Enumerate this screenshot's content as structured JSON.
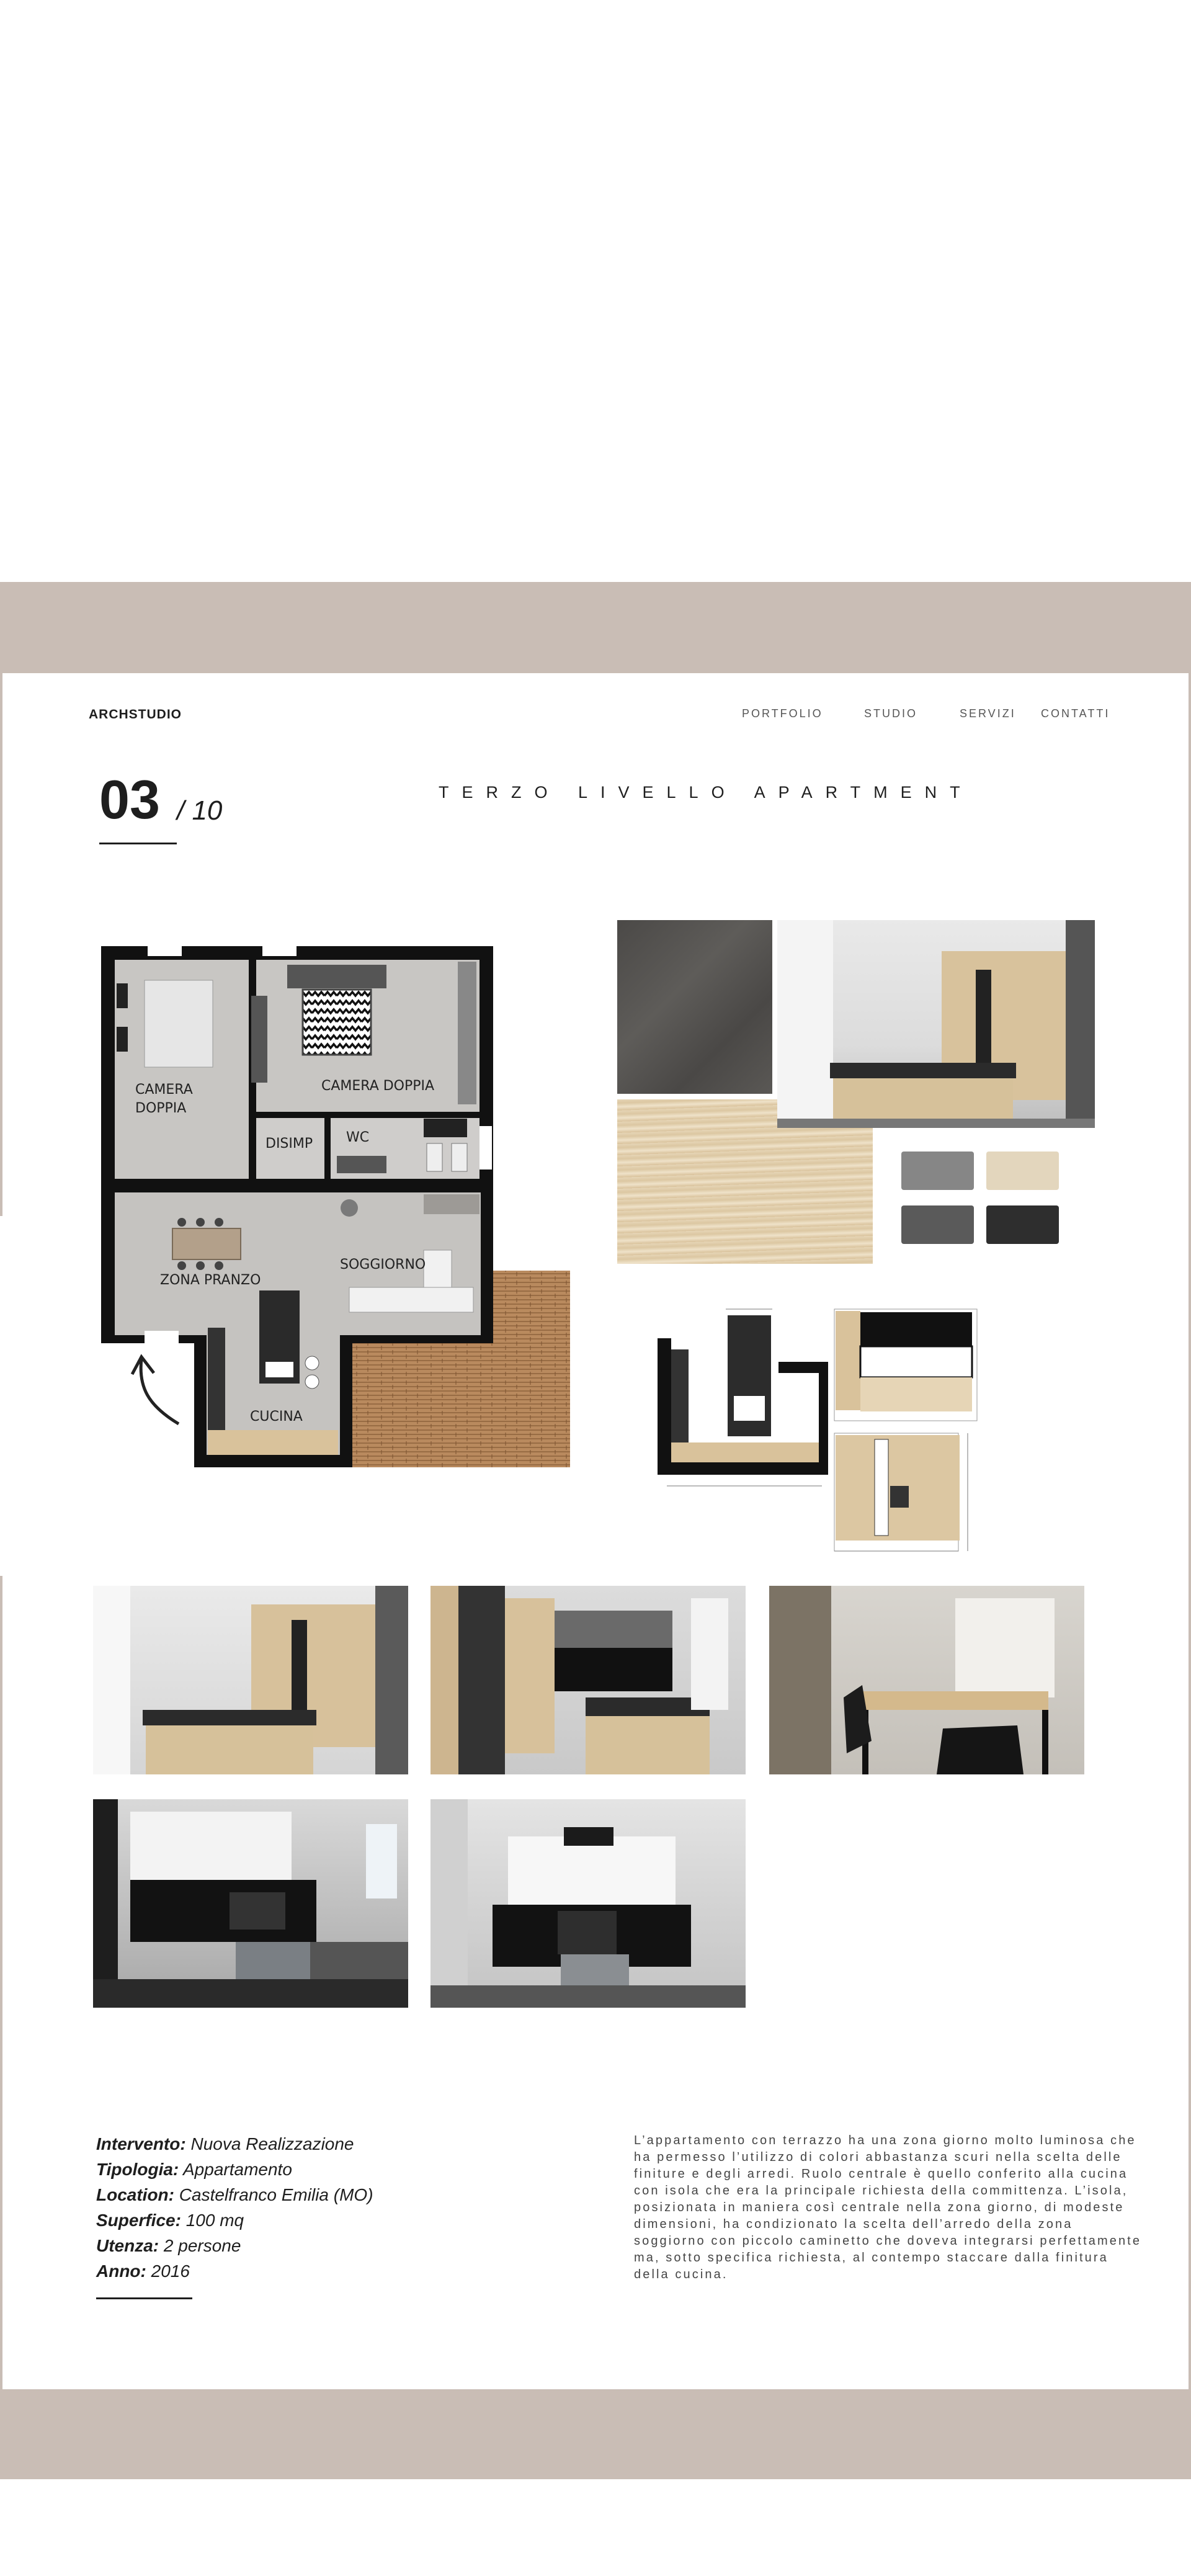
{
  "header": {
    "brand": "ARCHSTUDIO",
    "nav": [
      "PORTFOLIO",
      "STUDIO",
      "SERVIZI",
      "CONTATTI"
    ]
  },
  "page": {
    "number": "03",
    "total": "/ 10",
    "title": "TERZO LIVELLO APARTMENT"
  },
  "floorplan": {
    "rooms": [
      "CAMERA DOPPIA",
      "CAMERA DOPPIA",
      "DISIMP",
      "WC",
      "ZONA PRANZO",
      "SOGGIORNO",
      "CUCINA"
    ]
  },
  "swatches": [
    "#868686",
    "#e3d6bd",
    "#5a5a5a",
    "#2e2e2e"
  ],
  "project": {
    "intervento_label": "Intervento:",
    "intervento": "Nuova Realizzazione",
    "tipologia_label": "Tipologia:",
    "tipologia": "Appartamento",
    "location_label": "Location:",
    "location": "Castelfranco Emilia (MO)",
    "superfice_label": "Superfice:",
    "superfice": "100 mq",
    "utenza_label": "Utenza:",
    "utenza": "2 persone",
    "anno_label": "Anno:",
    "anno": "2016"
  },
  "description": "L’appartamento con terrazzo ha una zona giorno molto luminosa che ha permesso l’utilizzo di colori abbastanza scuri nella scelta delle finiture e degli arredi. Ruolo centrale è quello conferito alla cucina con isola che era la principale richiesta della committenza. L’isola, posizionata in maniera così centrale nella zona giorno, di modeste dimensioni, ha condizionato la scelta dell’arredo della zona soggiorno con piccolo caminetto che doveva integrarsi perfettamente ma, sotto specifica richiesta, al contempo staccare dalla finitura della cucina."
}
